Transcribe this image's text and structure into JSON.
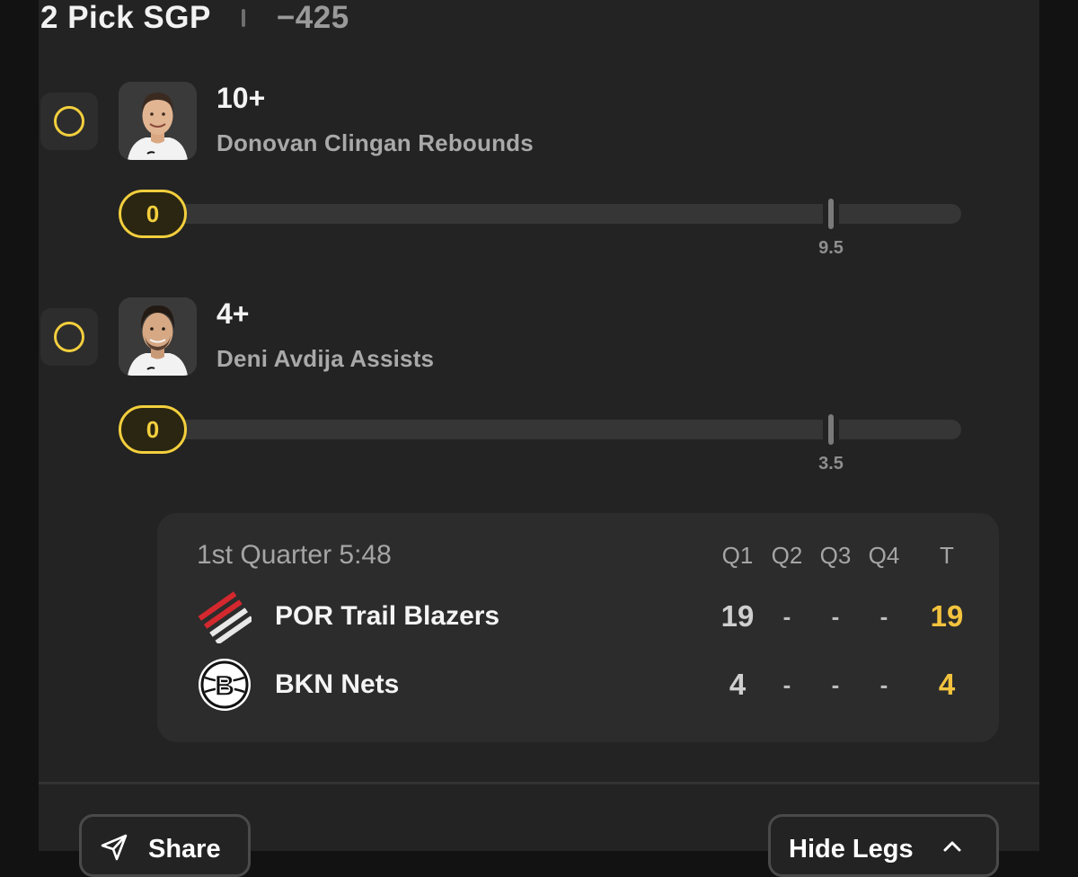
{
  "header": {
    "title": "2 Pick SGP",
    "odds": "−425"
  },
  "legs": [
    {
      "line": "10+",
      "description": "Donovan Clingan Rebounds",
      "current": "0",
      "target": "9.5",
      "progress": 0
    },
    {
      "line": "4+",
      "description": "Deni Avdija Assists",
      "current": "0",
      "target": "3.5",
      "progress": 0
    }
  ],
  "scoreboard": {
    "period": "1st Quarter 5:48",
    "columns": [
      "Q1",
      "Q2",
      "Q3",
      "Q4",
      "T"
    ],
    "teams": [
      {
        "name": "POR Trail Blazers",
        "scores": [
          "19",
          "-",
          "-",
          "-"
        ],
        "total": "19",
        "logo": "trail-blazers-logo"
      },
      {
        "name": "BKN Nets",
        "scores": [
          "4",
          "-",
          "-",
          "-"
        ],
        "total": "4",
        "logo": "nets-logo"
      }
    ]
  },
  "actions": {
    "share_label": "Share",
    "hide_label": "Hide Legs"
  },
  "colors": {
    "accent": "#f3cf3d",
    "total": "#f3c33e",
    "card": "#232323",
    "background": "#121212"
  }
}
